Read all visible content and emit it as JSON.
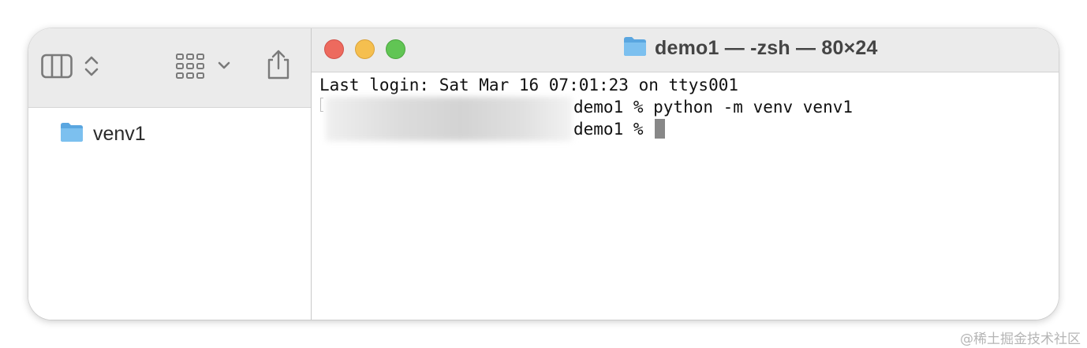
{
  "finder": {
    "toolbar": {
      "icons": [
        "sidebar-columns-icon",
        "sort-chevrons-icon",
        "grid-view-icon",
        "chevron-down-icon",
        "share-icon"
      ]
    },
    "items": [
      {
        "name": "venv1",
        "icon": "folder-icon"
      }
    ]
  },
  "terminal": {
    "title": "demo1 — -zsh — 80×24",
    "lines": {
      "login": "Last login: Sat Mar 16 07:01:23 on ttys001",
      "cmd1": "demo1 % python -m venv venv1",
      "cmd2": "demo1 % "
    },
    "traffic_lights": {
      "close": "#ed6a5e",
      "minimize": "#f5bf4f",
      "maximize": "#61c554"
    }
  },
  "watermark": "@稀土掘金技术社区"
}
